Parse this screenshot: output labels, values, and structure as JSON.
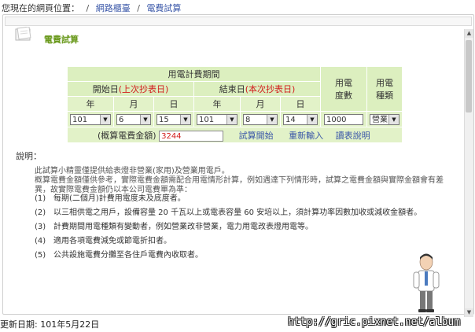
{
  "breadcrumb": {
    "prefix": "您現在的網頁位置：",
    "sep": "/",
    "items": [
      "網路櫃臺",
      "電費試算"
    ]
  },
  "page": {
    "title": "電費試算"
  },
  "table": {
    "period_header": "用電計費期間",
    "start_label": "開始日",
    "start_hint": "(上次抄表日)",
    "end_label": "結束日",
    "end_hint": "(本次抄表日)",
    "units_header": "用電度數",
    "type_header": "用電種類",
    "col_year": "年",
    "col_month": "月",
    "col_day": "日",
    "start": {
      "year": "101",
      "month": "6",
      "day": "15"
    },
    "end": {
      "year": "101",
      "month": "8",
      "day": "14"
    },
    "units_value": "1000",
    "type_value": "營業",
    "amount_label": "(概算電費金額)",
    "amount_value": "3244",
    "btn_calc": "試算開始",
    "btn_reset": "重新輸入",
    "btn_help": "讀表說明"
  },
  "explain": {
    "label": "說明：",
    "intro1": "此試算小精靈僅提供給表燈非營業(家用)及營業用電戶。",
    "intro2": "概算電費金額僅供參考，實際電費金額需配合用電情形計算，例如遇達下列情形時，試算之電費金額與實際金額會有差異，故實際電費金額仍以本公司電費單為準：",
    "items": [
      {
        "num": "(1)",
        "text": "每期(二個月)計費用電度未及底度者。"
      },
      {
        "num": "(2)",
        "text": "以三相供電之用戶，設備容量 20 千瓦以上或電表容量 60 安培以上，須計算功率因數加收或減收金額者。"
      },
      {
        "num": "(3)",
        "text": "計費期間用電種類有變動者，例如營業改非營業，電力用電改表燈用電等。"
      },
      {
        "num": "(4)",
        "text": "適用各項電費減免或節電折扣者。"
      },
      {
        "num": "(5)",
        "text": "公共設施電費分攤至各住戶電費內收取者。"
      }
    ]
  },
  "footer": {
    "updated": "更新日期: 101年5月22日"
  },
  "watermark": "http://gric.pixnet.net/album",
  "colors": {
    "green_title": "#6b9a1e",
    "cell_bg": "#e2f2c8",
    "link": "#3a57a8",
    "red": "#d21c1c"
  }
}
